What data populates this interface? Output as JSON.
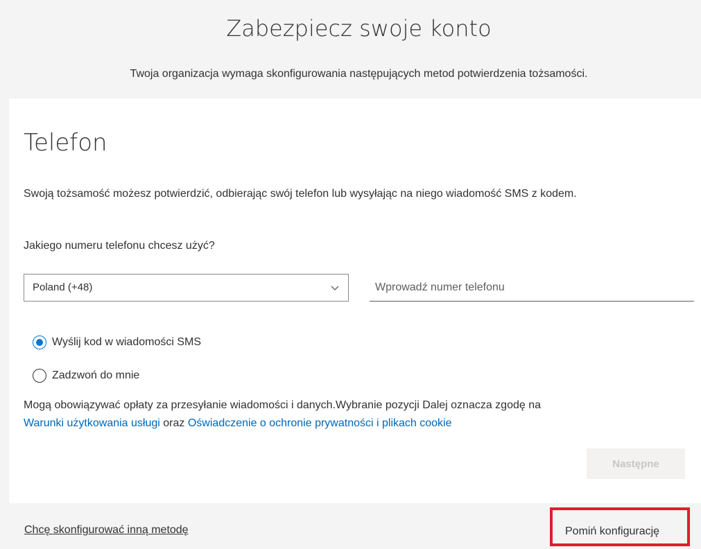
{
  "header": {
    "title": "Zabezpiecz swoje konto",
    "subtitle": "Twoja organizacja wymaga skonfigurowania następujących metod potwierdzenia tożsamości."
  },
  "card": {
    "title": "Telefon",
    "description": "Swoją tożsamość możesz potwierdzić, odbierając swój telefon lub wysyłając na niego wiadomość SMS z kodem.",
    "question": "Jakiego numeru telefonu chcesz użyć?",
    "country_select": {
      "value": "Poland (+48)",
      "icon": "chevron-down-icon"
    },
    "phone_input": {
      "value": "",
      "placeholder": "Wprowadź numer telefonu"
    },
    "options": [
      {
        "label": "Wyślij kod w wiadomości SMS",
        "checked": true
      },
      {
        "label": "Zadzwoń do mnie",
        "checked": false
      }
    ],
    "terms": {
      "text": "Mogą obowiązywać opłaty za przesyłanie wiadomości i danych.Wybranie pozycji Dalej oznacza zgodę na",
      "link1": "Warunki użytkowania usługi",
      "connector": "oraz",
      "link2": "Oświadczenie o ochronie prywatności i plikach cookie"
    },
    "next_button": "Następne"
  },
  "footer": {
    "other_method": "Chcę skonfigurować inną metodę",
    "skip": "Pomiń konfigurację"
  },
  "colors": {
    "accent": "#0078d4",
    "link": "#0067b8",
    "highlight_border": "#e11e2c",
    "disabled_text": "#c8c6c4"
  }
}
